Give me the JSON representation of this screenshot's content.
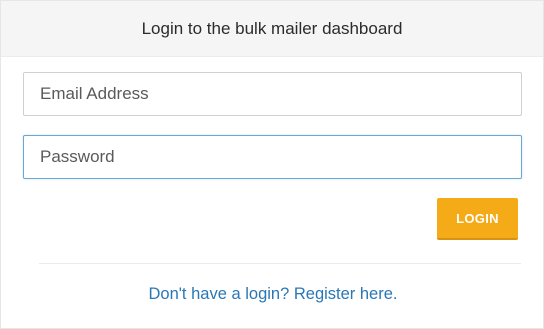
{
  "header": {
    "title": "Login to the bulk mailer dashboard"
  },
  "form": {
    "email": {
      "value": "",
      "placeholder": "Email Address"
    },
    "password": {
      "value": "",
      "placeholder": "Password"
    },
    "login_label": "LOGIN"
  },
  "footer": {
    "register_link": "Don't have a login? Register here."
  },
  "colors": {
    "accent_button": "#f5ab17",
    "link": "#2a77b6",
    "focus_border": "#66a8d8"
  }
}
